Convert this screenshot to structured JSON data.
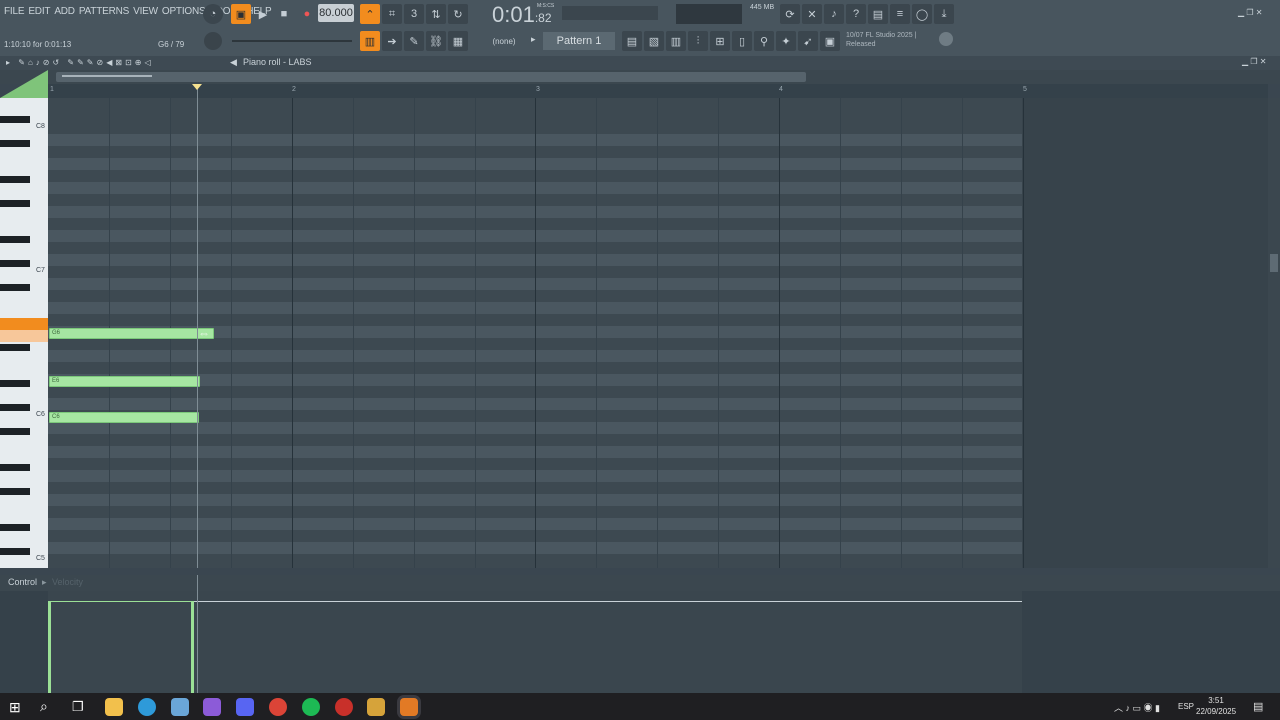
{
  "menu": [
    "FILE",
    "EDIT",
    "ADD",
    "PATTERNS",
    "VIEW",
    "OPTIONS",
    "TOOLS",
    "HELP"
  ],
  "transport": {
    "tempo": "80.000",
    "time": "0:01",
    "time_sub": ":82",
    "time_label": "M:S:CS"
  },
  "memory": "445 MB",
  "hint": {
    "left": "1:10:10 for 0:01:13",
    "right": "G6 / 79"
  },
  "pattern": {
    "selector": "(none)",
    "name": "Pattern 1"
  },
  "news": {
    "line1": "10/07  FL Studio 2025 |",
    "line2": "Released"
  },
  "piano_roll": {
    "title": "Piano roll - LABS",
    "bars": [
      "1",
      "2",
      "3",
      "4",
      "5"
    ],
    "key_labels": [
      "C8",
      "C7",
      "C6",
      "C5"
    ],
    "notes": [
      {
        "label": "G6",
        "pitch": "G6"
      },
      {
        "label": "E6",
        "pitch": "E6"
      },
      {
        "label": "C6",
        "pitch": "C6"
      }
    ]
  },
  "control": {
    "label": "Control",
    "target": "Velocity"
  },
  "taskbar": {
    "lang": "ESP",
    "time": "3:51",
    "date": "22/09/2025"
  }
}
